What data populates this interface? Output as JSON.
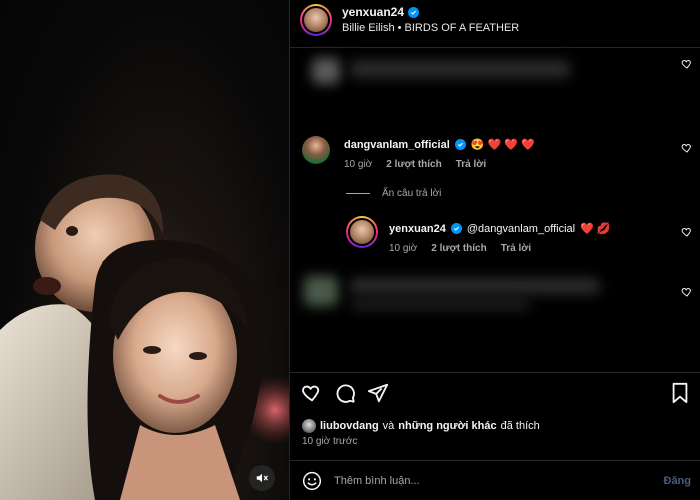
{
  "header": {
    "username": "yenxuan24",
    "audio": "Billie Eilish • BIRDS OF A FEATHER"
  },
  "comments": [
    {
      "username": "dangvanlam_official",
      "text": "😍 ❤️ ❤️ ❤️",
      "time": "10 giờ",
      "likes": "2 lượt thích",
      "reply": "Trả lời"
    }
  ],
  "hide_replies": "Ẩn câu trả lời",
  "reply": {
    "username": "yenxuan24",
    "mention": "@dangvanlam_official",
    "emoji": "❤️ 💋",
    "time": "10 giờ",
    "likes": "2 lượt thích",
    "reply": "Trả lời"
  },
  "likes_line": {
    "user": "liubovdang",
    "connector": "và",
    "others": "những người khác",
    "suffix": "đã thích"
  },
  "time_ago": "10 giờ trước",
  "comment_input": {
    "placeholder": "Thêm bình luận...",
    "post_label": "Đăng"
  },
  "icons": {
    "like": "heart-icon",
    "comment": "comment-icon",
    "share": "share-icon",
    "save": "bookmark-icon",
    "emoji": "emoji-icon",
    "mute": "speaker-muted-icon",
    "verified": "verified-badge-icon"
  },
  "colors": {
    "verified": "#0095f6",
    "heart": "#ff3040",
    "post_disabled": "#4a5d80"
  }
}
